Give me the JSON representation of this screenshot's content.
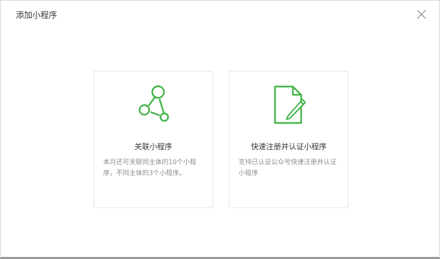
{
  "dialog": {
    "title": "添加小程序",
    "close_icon": "close-icon"
  },
  "colors": {
    "accent": "#44b549",
    "title_text": "#353535",
    "desc_text": "#8d8d8d",
    "card_border": "#e7e7e7"
  },
  "cards": [
    {
      "icon": "link-nodes-icon",
      "title": "关联小程序",
      "description": "本月还可关联同主体的10个小程序，不同主体的3个小程序。"
    },
    {
      "icon": "document-edit-icon",
      "title": "快速注册并认证小程序",
      "description": "支持已认证公众号快速注册并认证小程序"
    }
  ]
}
